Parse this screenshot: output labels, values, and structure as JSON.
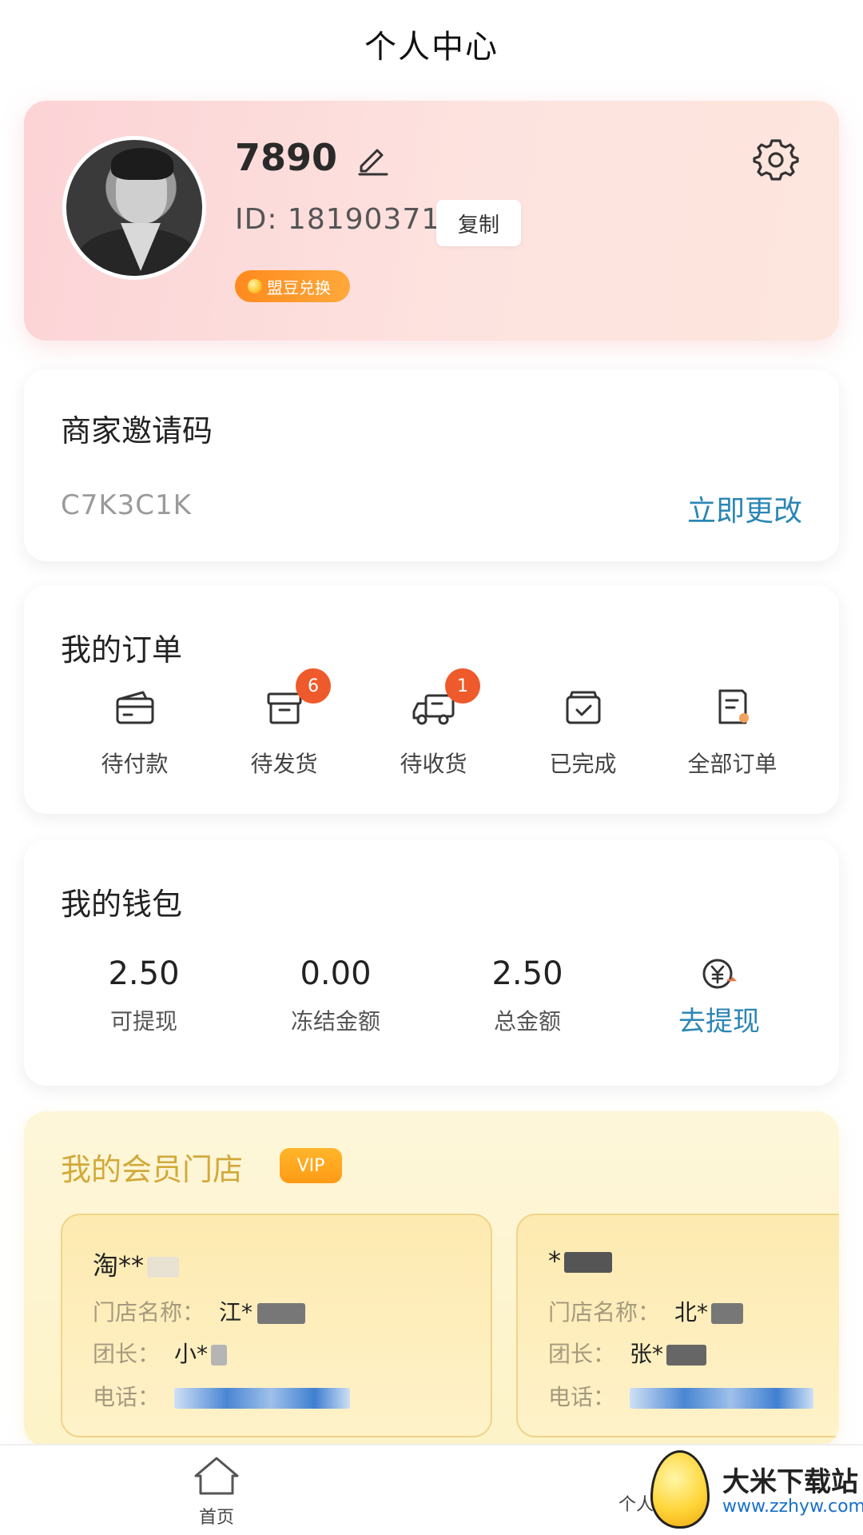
{
  "header": {
    "title": "个人中心"
  },
  "profile": {
    "username": "7890",
    "user_id": "ID: 18190371",
    "copy_label": "复制",
    "bean_label": "盟豆兑换"
  },
  "invite": {
    "title": "商家邀请码",
    "code": "C7K3C1K",
    "change_label": "立即更改"
  },
  "orders": {
    "title": "我的订单",
    "items": [
      {
        "label": "待付款",
        "icon": "wallet-card-icon",
        "badge": ""
      },
      {
        "label": "待发货",
        "icon": "box-icon",
        "badge": "6"
      },
      {
        "label": "待收货",
        "icon": "truck-icon",
        "badge": "1"
      },
      {
        "label": "已完成",
        "icon": "completed-box-icon",
        "badge": ""
      },
      {
        "label": "全部订单",
        "icon": "document-icon",
        "badge": ""
      }
    ]
  },
  "wallet": {
    "title": "我的钱包",
    "items": [
      {
        "value": "2.50",
        "label": "可提现"
      },
      {
        "value": "0.00",
        "label": "冻结金额"
      },
      {
        "value": "2.50",
        "label": "总金额"
      }
    ],
    "withdraw_label": "去提现"
  },
  "vip": {
    "title": "我的会员门店",
    "tag": "VIP",
    "stores": [
      {
        "name": "淘**",
        "shop_label": "门店名称：",
        "shop_value": "江*",
        "leader_label": "团长：",
        "leader_value": "小*",
        "phone_label": "电话："
      },
      {
        "name": "*",
        "shop_label": "门店名称：",
        "shop_value": "北*",
        "leader_label": "团长：",
        "leader_value": "张*",
        "phone_label": "电话："
      }
    ]
  },
  "nav": {
    "home_label": "首页",
    "profile_label": "个人"
  },
  "watermark": {
    "text": "大米下载站",
    "url": "www.zzhyw.com"
  },
  "colors": {
    "accent_blue": "#2b86b4",
    "badge_red": "#ee5a2c",
    "vip_gold": "#d2a93a"
  }
}
